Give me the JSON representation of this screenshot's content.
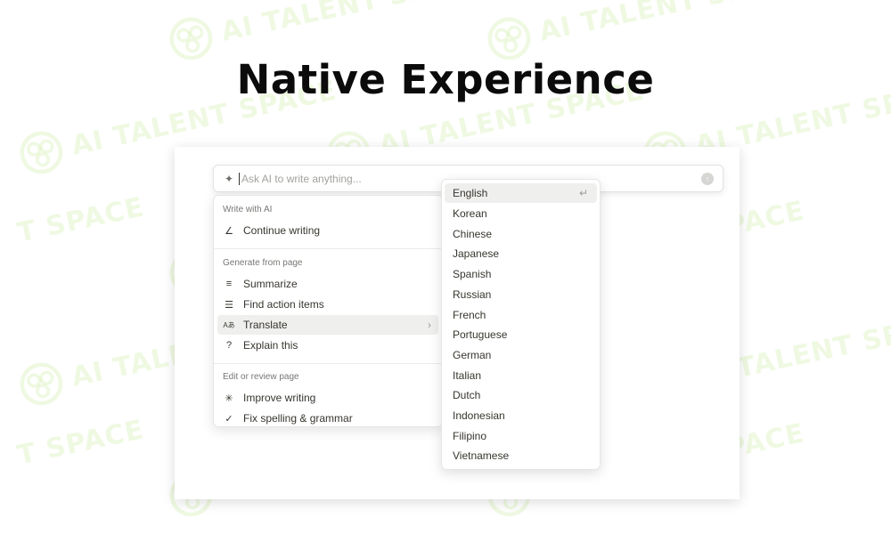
{
  "page": {
    "headline": "Native Experience"
  },
  "watermark": {
    "text": "AI TALENT SPACE",
    "partial_text": "T SPACE",
    "color": "#b4e07a"
  },
  "ai_bar": {
    "placeholder": "Ask AI to write anything...",
    "sparkle_icon": "sparkle-icon",
    "submit_icon": "submit-arrow-icon"
  },
  "menu": {
    "sections": [
      {
        "title": "Write with AI",
        "items": [
          {
            "label": "Continue writing",
            "icon": "pencil-icon"
          }
        ]
      },
      {
        "title": "Generate from page",
        "items": [
          {
            "label": "Summarize",
            "icon": "summarize-icon"
          },
          {
            "label": "Find action items",
            "icon": "checklist-icon"
          },
          {
            "label": "Translate",
            "icon": "translate-icon",
            "has_submenu": true,
            "active": true
          },
          {
            "label": "Explain this",
            "icon": "question-icon"
          }
        ]
      },
      {
        "title": "Edit or review page",
        "items": [
          {
            "label": "Improve writing",
            "icon": "magic-wand-icon"
          },
          {
            "label": "Fix spelling & grammar",
            "icon": "check-icon"
          }
        ]
      }
    ]
  },
  "translate_submenu": {
    "languages": [
      "English",
      "Korean",
      "Chinese",
      "Japanese",
      "Spanish",
      "Russian",
      "French",
      "Portuguese",
      "German",
      "Italian",
      "Dutch",
      "Indonesian",
      "Filipino",
      "Vietnamese"
    ],
    "highlighted": "English",
    "enter_icon": "return-key-icon"
  }
}
